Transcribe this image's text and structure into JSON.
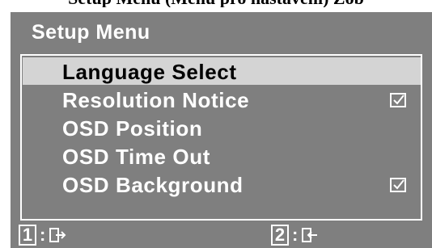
{
  "document": {
    "header": "Setup Menu (Menu pro nastavení) Zob"
  },
  "osd": {
    "title": "Setup Menu",
    "items": [
      {
        "label": "Language Select",
        "selected": true,
        "checkbox": false
      },
      {
        "label": "Resolution Notice",
        "selected": false,
        "checkbox": true
      },
      {
        "label": "OSD Position",
        "selected": false,
        "checkbox": false
      },
      {
        "label": "OSD Time Out",
        "selected": false,
        "checkbox": false
      },
      {
        "label": "OSD Background",
        "selected": false,
        "checkbox": true
      }
    ],
    "footer": {
      "key1": "1",
      "key2": "2",
      "separator": ":",
      "key1_action_icon": "exit-icon",
      "key2_action_icon": "enter-icon"
    }
  },
  "colors": {
    "panel": "#7f7f7f",
    "highlight": "#d4d4d4",
    "text": "#ffffff",
    "selected_text": "#000000"
  }
}
